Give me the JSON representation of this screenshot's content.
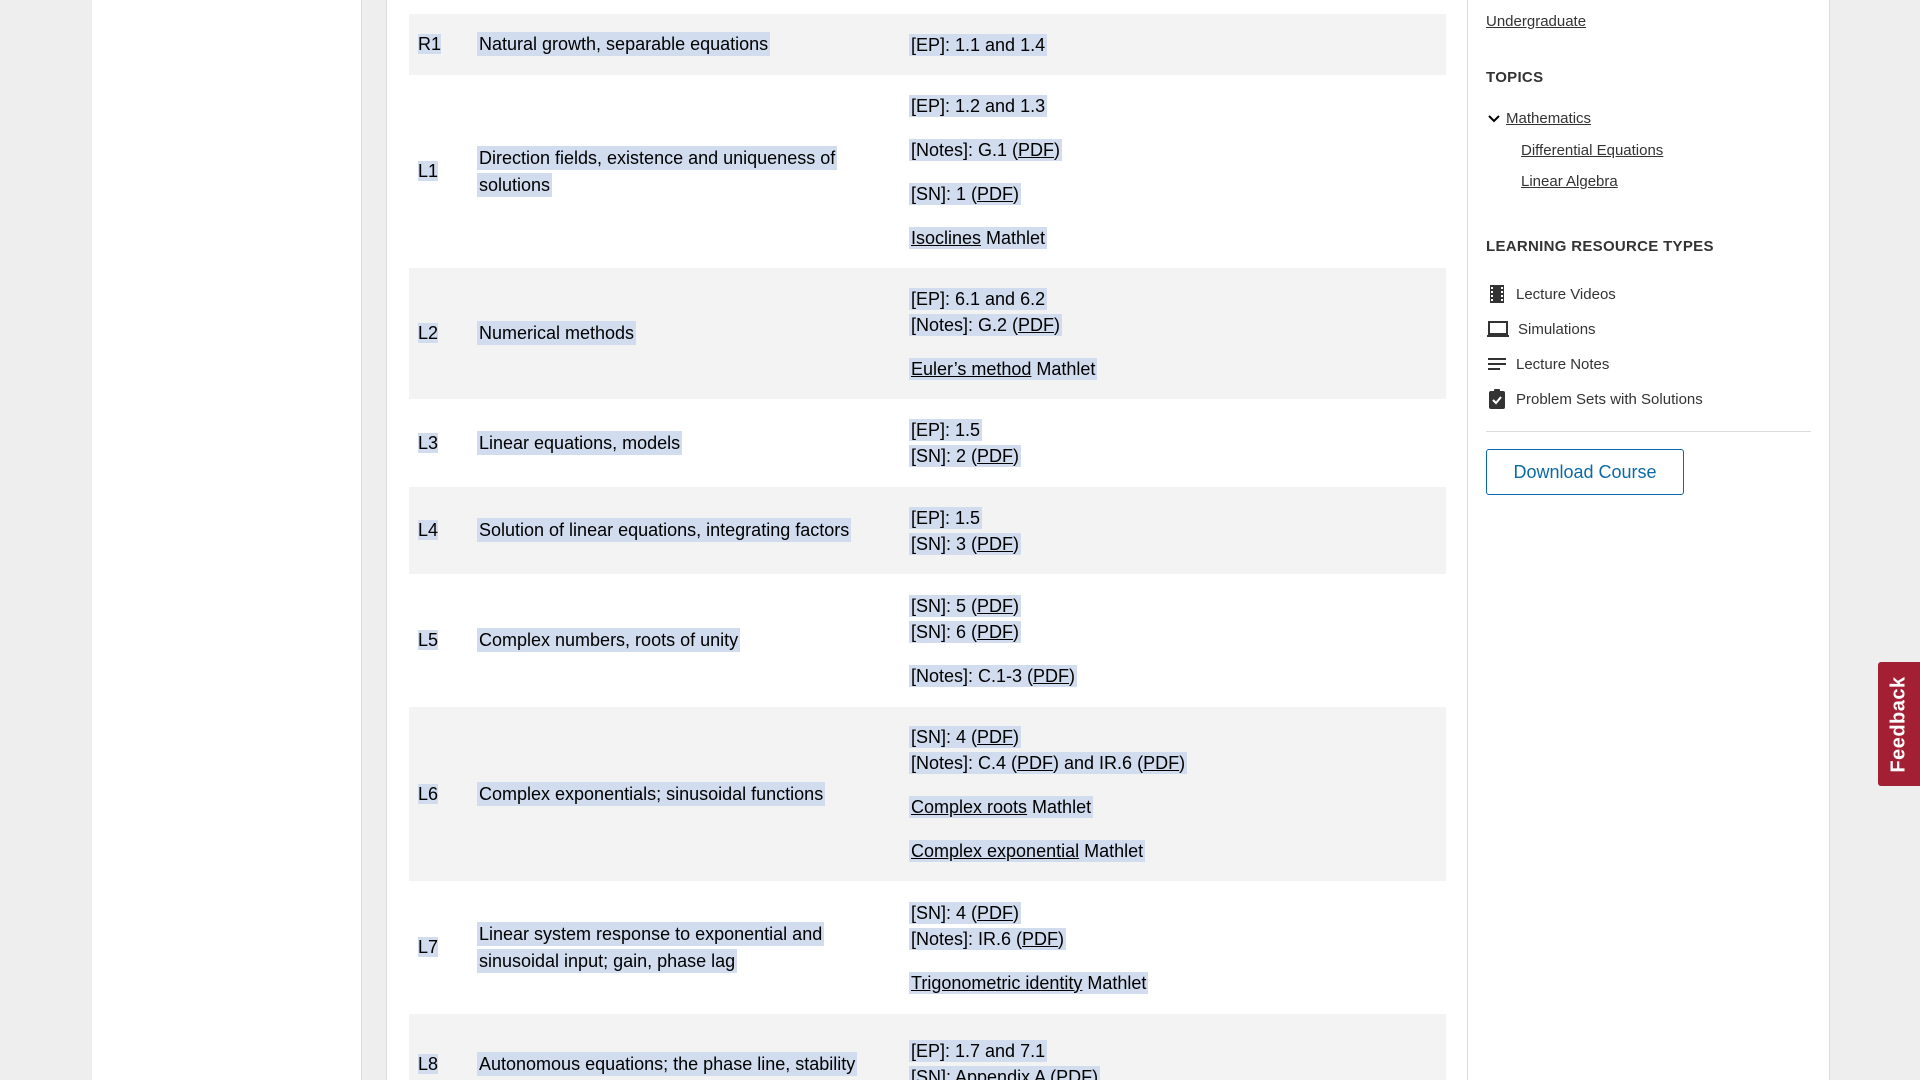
{
  "table": {
    "rows": [
      {
        "id": "R1",
        "topic": [
          "Natural growth, separable equations"
        ],
        "resources": [
          [
            {
              "t": "[EP]: 1.1 and 1.4"
            }
          ]
        ]
      },
      {
        "id": "L1",
        "topic": [
          "Direction fields, existence and uniqueness of",
          "solutions"
        ],
        "resources": [
          [
            {
              "t": "[EP]: 1.2 and 1.3"
            }
          ],
          "gap",
          [
            {
              "t": "[Notes]: G.1 ("
            },
            {
              "t": "PDF",
              "link": true
            },
            {
              "t": ")"
            }
          ],
          "gap",
          [
            {
              "t": "[SN]: 1 ("
            },
            {
              "t": "PDF",
              "link": true
            },
            {
              "t": ")"
            }
          ],
          "gap",
          [
            {
              "t": "Isoclines",
              "link": true
            },
            {
              "t": " Mathlet"
            }
          ]
        ]
      },
      {
        "id": "L2",
        "topic": [
          "Numerical methods"
        ],
        "resources": [
          [
            {
              "t": "[EP]: 6.1 and 6.2"
            }
          ],
          [
            {
              "t": "[Notes]: G.2 ("
            },
            {
              "t": "PDF",
              "link": true
            },
            {
              "t": ")"
            }
          ],
          "gap",
          [
            {
              "t": "Euler’s method",
              "link": true
            },
            {
              "t": " Mathlet"
            }
          ]
        ]
      },
      {
        "id": "L3",
        "topic": [
          "Linear equations, models"
        ],
        "resources": [
          [
            {
              "t": "[EP]: 1.5"
            }
          ],
          [
            {
              "t": "[SN]: 2 ("
            },
            {
              "t": "PDF",
              "link": true
            },
            {
              "t": ")"
            }
          ]
        ]
      },
      {
        "id": "L4",
        "topic": [
          "Solution of linear equations, integrating factors"
        ],
        "resources": [
          [
            {
              "t": "[EP]: 1.5"
            }
          ],
          [
            {
              "t": "[SN]: 3 ("
            },
            {
              "t": "PDF",
              "link": true
            },
            {
              "t": ")"
            }
          ]
        ]
      },
      {
        "id": "L5",
        "topic": [
          "Complex numbers, roots of unity"
        ],
        "resources": [
          [
            {
              "t": "[SN]: 5 ("
            },
            {
              "t": "PDF",
              "link": true
            },
            {
              "t": ")"
            }
          ],
          [
            {
              "t": "[SN]: 6 ("
            },
            {
              "t": "PDF",
              "link": true
            },
            {
              "t": ")"
            }
          ],
          "gap",
          [
            {
              "t": "[Notes]: C.1-3 ("
            },
            {
              "t": "PDF",
              "link": true
            },
            {
              "t": ")"
            }
          ]
        ]
      },
      {
        "id": "L6",
        "topic": [
          "Complex exponentials; sinusoidal functions"
        ],
        "resources": [
          [
            {
              "t": "[SN]: 4 ("
            },
            {
              "t": "PDF",
              "link": true
            },
            {
              "t": ")"
            }
          ],
          [
            {
              "t": "[Notes]: C.4 ("
            },
            {
              "t": "PDF",
              "link": true
            },
            {
              "t": ") and IR.6 ("
            },
            {
              "t": "PDF",
              "link": true
            },
            {
              "t": ")"
            }
          ],
          "gap",
          [
            {
              "t": "Complex roots",
              "link": true
            },
            {
              "t": " Mathlet"
            }
          ],
          "gap",
          [
            {
              "t": "Complex exponential",
              "link": true
            },
            {
              "t": " Mathlet"
            }
          ]
        ]
      },
      {
        "id": "L7",
        "topic": [
          "Linear system response to exponential and",
          "sinusoidal input; gain, phase lag"
        ],
        "resources": [
          [
            {
              "t": "[SN]: 4 ("
            },
            {
              "t": "PDF",
              "link": true
            },
            {
              "t": ")"
            }
          ],
          [
            {
              "t": "[Notes]: IR.6 ("
            },
            {
              "t": "PDF",
              "link": true
            },
            {
              "t": ")"
            }
          ],
          "gap",
          [
            {
              "t": "Trigonometric identity",
              "link": true
            },
            {
              "t": " Mathlet"
            }
          ]
        ]
      },
      {
        "id": "L8",
        "topic": [
          "Autonomous equations; the phase line, stability"
        ],
        "resources": [
          [
            {
              "t": "[EP]: 1.7 and 7.1"
            }
          ],
          [
            {
              "t": "[SN]: Appendix A ("
            },
            {
              "t": "PDF",
              "link": true
            },
            {
              "t": ")"
            }
          ]
        ]
      }
    ]
  },
  "sidebar": {
    "level_link": "Undergraduate",
    "topics_heading": "TOPICS",
    "topic_parent": "Mathematics",
    "topic_children": [
      "Differential Equations",
      "Linear Algebra"
    ],
    "lrt_heading": "LEARNING RESOURCE TYPES",
    "lrt_items": [
      {
        "icon": "film-icon",
        "label": "Lecture Videos"
      },
      {
        "icon": "laptop-icon",
        "label": "Simulations"
      },
      {
        "icon": "notes-icon",
        "label": "Lecture Notes"
      },
      {
        "icon": "clipboard-check-icon",
        "label": "Problem Sets with Solutions"
      }
    ],
    "download_label": "Download Course"
  },
  "feedback_label": "Feedback",
  "colors": {
    "accent": "#0a6aa5",
    "feedback": "#a31f34",
    "selection": "#d1dcee"
  }
}
